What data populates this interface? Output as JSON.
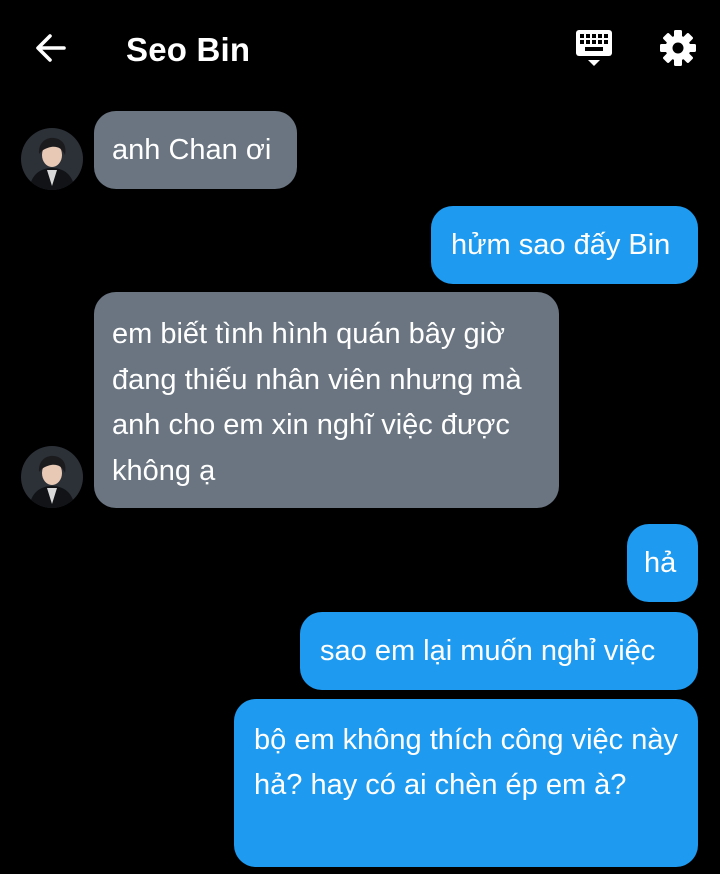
{
  "header": {
    "title": "Seo Bin",
    "back_icon": "arrow-left-icon",
    "keyboard_icon": "keyboard-icon",
    "settings_icon": "gear-icon"
  },
  "colors": {
    "background": "#000000",
    "incoming_bubble": "#6a7581",
    "outgoing_bubble": "#1e9bf0",
    "text": "#ffffff"
  },
  "messages": [
    {
      "sender": "Seo Bin",
      "direction": "incoming",
      "text": "anh Chan ơi"
    },
    {
      "sender": "me",
      "direction": "outgoing",
      "text": "hửm sao đấy Bin"
    },
    {
      "sender": "Seo Bin",
      "direction": "incoming",
      "text": "em biết tình hình quán bây giờ đang thiếu nhân viên nhưng mà anh cho em xin nghĩ việc được không ạ"
    },
    {
      "sender": "me",
      "direction": "outgoing",
      "text": "hả"
    },
    {
      "sender": "me",
      "direction": "outgoing",
      "text": "sao em lại muốn nghỉ việc"
    },
    {
      "sender": "me",
      "direction": "outgoing",
      "text": "bộ em không thích công việc này hả? hay có ai chèn ép em à?"
    }
  ]
}
